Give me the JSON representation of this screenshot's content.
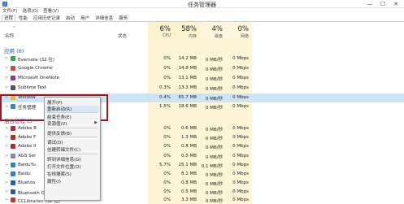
{
  "window": {
    "title": "任务管理器",
    "minimize": "—",
    "maximize": "☐",
    "close": "✕"
  },
  "menubar": [
    "文件(F)",
    "选项(O)",
    "查看(V)"
  ],
  "tabs": [
    "进程",
    "性能",
    "应用历史记录",
    "启动",
    "用户",
    "详细信息",
    "服务"
  ],
  "columns": {
    "name": "名称",
    "status": "状态"
  },
  "stats": [
    {
      "pct": "6%",
      "label": "CPU"
    },
    {
      "pct": "58%",
      "label": "内存"
    },
    {
      "pct": "4%",
      "label": "磁盘"
    },
    {
      "pct": "0%",
      "label": "网络"
    }
  ],
  "sections": {
    "apps": "应用 (6)",
    "background": "后台进程 (3"
  },
  "apps": [
    {
      "name": "Evernote (32 位)",
      "cpu": "0%",
      "mem": "14.2 MB",
      "disk": "0 MB/秒",
      "net": "0 Mbps",
      "color": "#3fa24a"
    },
    {
      "name": "Google Chrome",
      "cpu": "0%",
      "mem": "14.8 MB",
      "disk": "0 MB/秒",
      "net": "0 Mbps",
      "color": "#d9463a"
    },
    {
      "name": "Microsoft OneNote",
      "cpu": "0%",
      "mem": "13.1 MB",
      "disk": "0 MB/秒",
      "net": "0 Mbps",
      "color": "#7b3fa0"
    },
    {
      "name": "Sublime Text",
      "cpu": "0.3%",
      "mem": "13.3 MB",
      "disk": "0 MB/秒",
      "net": "0 Mbps",
      "color": "#555555"
    },
    {
      "name": "Window",
      "cpu": "0.4%",
      "mem": "65.7 MB",
      "disk": "0 MB/秒",
      "net": "0 Mbps",
      "color": "#e1b64a"
    },
    {
      "name": "任务管理",
      "cpu": "1.5%",
      "mem": "18.6 MB",
      "disk": "0 MB/秒",
      "net": "0 Mbps",
      "color": "#3b7fc4"
    }
  ],
  "background": [
    {
      "name": "Adobe B",
      "cpu": "0%",
      "mem": "0.6 MB",
      "disk": "0 MB/秒",
      "net": "0 Mbps",
      "color": "#b52a2a"
    },
    {
      "name": "Adobe F",
      "cpu": "0%",
      "mem": "1.3 MB",
      "disk": "0 MB/秒",
      "net": "0 Mbps",
      "color": "#b52a2a"
    },
    {
      "name": "Adobe II",
      "cpu": "0%",
      "mem": "0.8 MB",
      "disk": "0 MB/秒",
      "net": "0 Mbps",
      "color": "#b52a2a"
    },
    {
      "name": "AGS Ser",
      "cpu": "0%",
      "mem": "0.5 MB",
      "disk": "0 MB/秒",
      "net": "0 Mbps",
      "color": "#8a8a8a"
    },
    {
      "name": "BaiduYu",
      "cpu": "5.7%",
      "mem": "25.1 MB",
      "disk": "0.1 MB/秒",
      "net": "0 Mbps",
      "color": "#2f7fd6"
    },
    {
      "name": "Baidu",
      "cpu": "0%",
      "mem": "8.1 MB",
      "disk": "0 MB/秒",
      "net": "0 Mbps",
      "color": "#2f7fd6"
    },
    {
      "name": "Bluetoo",
      "cpu": "0%",
      "mem": "0.8 MB",
      "disk": "0 MB/秒",
      "net": "0 Mbps",
      "color": "#1f5fb0"
    },
    {
      "name": "Bluetooth OBEX Service (32 位)",
      "cpu": "0%",
      "mem": "0.5 MB",
      "disk": "0 MB/秒",
      "net": "0 Mbps",
      "color": "#1f5fb0"
    },
    {
      "name": "CCLibraries (32 位)",
      "cpu": "0%",
      "mem": "3.3 MB",
      "disk": "0 MB/秒",
      "net": "0 Mbps",
      "color": "#c0392b"
    }
  ],
  "context_menu": [
    "展开(P)",
    "重新启动(R)",
    "结束任务(E)",
    "资源值(V)",
    "提供反馈(B)",
    "调试(D)",
    "创建转储文件(C)",
    "转到详细信息(G)",
    "打开文件位置(O)",
    "在线搜索(S)",
    "属性(I)"
  ]
}
